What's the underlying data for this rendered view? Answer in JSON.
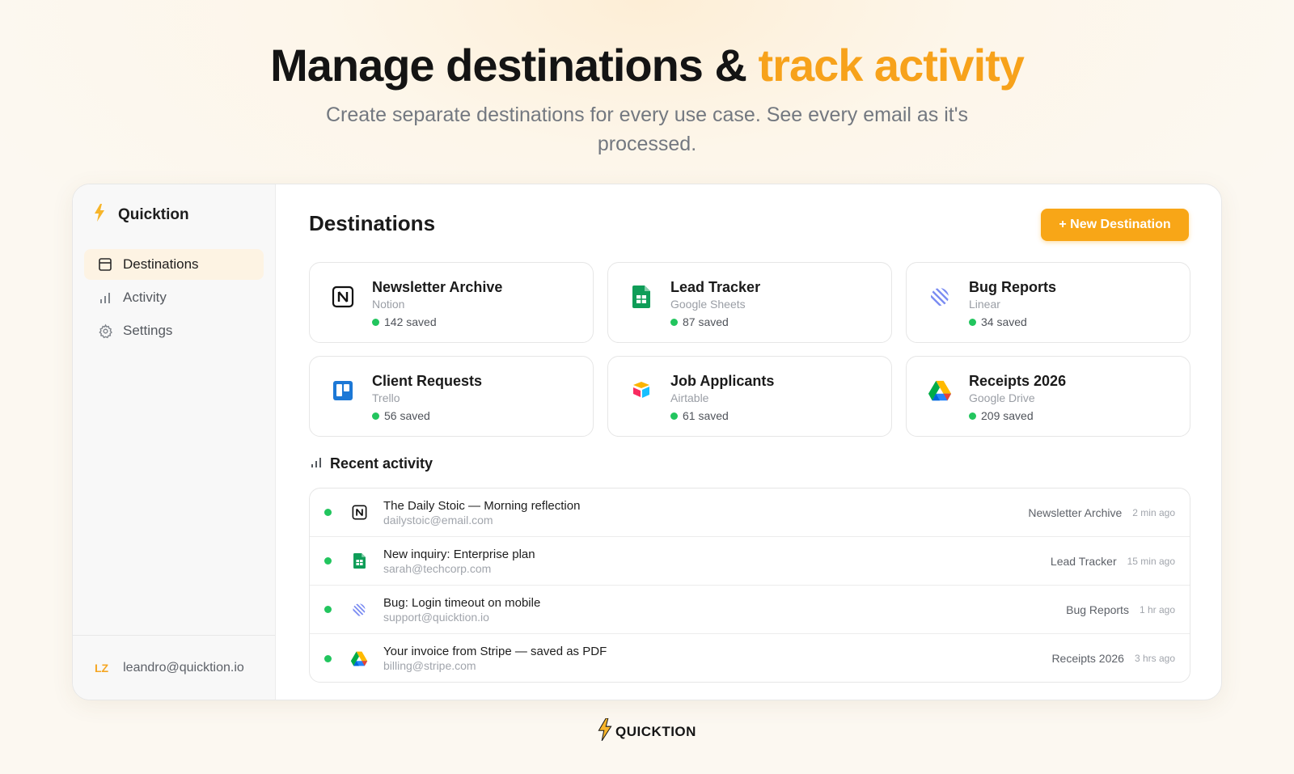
{
  "hero": {
    "title_main": "Manage destinations & ",
    "title_accent": "track activity",
    "subtitle": "Create separate destinations for every use case. See every email as it's processed."
  },
  "colors": {
    "accent": "#f8a617",
    "success": "#22c55e"
  },
  "sidebar": {
    "brand_name": "Quicktion",
    "brand_icon": "lightning-bolt-icon",
    "items": [
      {
        "label": "Destinations",
        "icon": "layout-icon",
        "active": true
      },
      {
        "label": "Activity",
        "icon": "bar-chart-icon",
        "active": false
      },
      {
        "label": "Settings",
        "icon": "gear-icon",
        "active": false
      }
    ],
    "user": {
      "initials": "LZ",
      "email": "leandro@quicktion.io"
    }
  },
  "main": {
    "title": "Destinations",
    "new_button_label": "+ New Destination",
    "destinations": [
      {
        "name": "Newsletter Archive",
        "service": "Notion",
        "count": "142 saved",
        "icon": "notion-icon"
      },
      {
        "name": "Lead Tracker",
        "service": "Google Sheets",
        "count": "87 saved",
        "icon": "google-sheets-icon"
      },
      {
        "name": "Bug Reports",
        "service": "Linear",
        "count": "34 saved",
        "icon": "linear-icon"
      },
      {
        "name": "Client Requests",
        "service": "Trello",
        "count": "56 saved",
        "icon": "trello-icon"
      },
      {
        "name": "Job Applicants",
        "service": "Airtable",
        "count": "61 saved",
        "icon": "airtable-icon"
      },
      {
        "name": "Receipts 2026",
        "service": "Google Drive",
        "count": "209 saved",
        "icon": "google-drive-icon"
      }
    ],
    "recent": {
      "title": "Recent activity",
      "items": [
        {
          "subject": "The Daily Stoic — Morning reflection",
          "sender": "dailystoic@email.com",
          "destination": "Newsletter Archive",
          "time": "2 min ago",
          "icon": "notion-icon"
        },
        {
          "subject": "New inquiry: Enterprise plan",
          "sender": "sarah@techcorp.com",
          "destination": "Lead Tracker",
          "time": "15 min ago",
          "icon": "google-sheets-icon"
        },
        {
          "subject": "Bug: Login timeout on mobile",
          "sender": "support@quicktion.io",
          "destination": "Bug Reports",
          "time": "1 hr ago",
          "icon": "linear-icon"
        },
        {
          "subject": "Your invoice from Stripe — saved as PDF",
          "sender": "billing@stripe.com",
          "destination": "Receipts 2026",
          "time": "3 hrs ago",
          "icon": "google-drive-icon"
        }
      ]
    }
  },
  "footer": {
    "brand": "QUICKTION"
  }
}
